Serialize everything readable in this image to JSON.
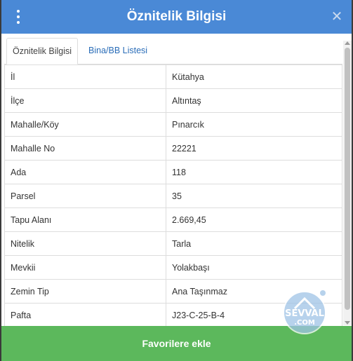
{
  "header": {
    "title": "Öznitelik Bilgisi",
    "close_symbol": "✕"
  },
  "tabs": [
    {
      "label": "Öznitelik Bilgisi",
      "active": true
    },
    {
      "label": "Bina/BB Listesi",
      "active": false
    }
  ],
  "attributes": [
    {
      "key": "İl",
      "value": "Kütahya"
    },
    {
      "key": "İlçe",
      "value": "Altıntaş"
    },
    {
      "key": "Mahalle/Köy",
      "value": "Pınarcık"
    },
    {
      "key": "Mahalle No",
      "value": "22221"
    },
    {
      "key": "Ada",
      "value": "118"
    },
    {
      "key": "Parsel",
      "value": "35"
    },
    {
      "key": "Tapu Alanı",
      "value": "2.669,45"
    },
    {
      "key": "Nitelik",
      "value": "Tarla"
    },
    {
      "key": "Mevkii",
      "value": "Yolakbaşı"
    },
    {
      "key": "Zemin Tip",
      "value": "Ana Taşınmaz"
    },
    {
      "key": "Pafta",
      "value": "J23-C-25-B-4"
    }
  ],
  "footer": {
    "button_label": "Favorilere ekle"
  },
  "watermark": {
    "line1": "SEVVAL",
    "line2": ".COM"
  },
  "colors": {
    "header_bg": "#4a89d6",
    "footer_bg": "#5cb85c",
    "tab_link": "#2a6db8",
    "border": "#dddddd"
  }
}
